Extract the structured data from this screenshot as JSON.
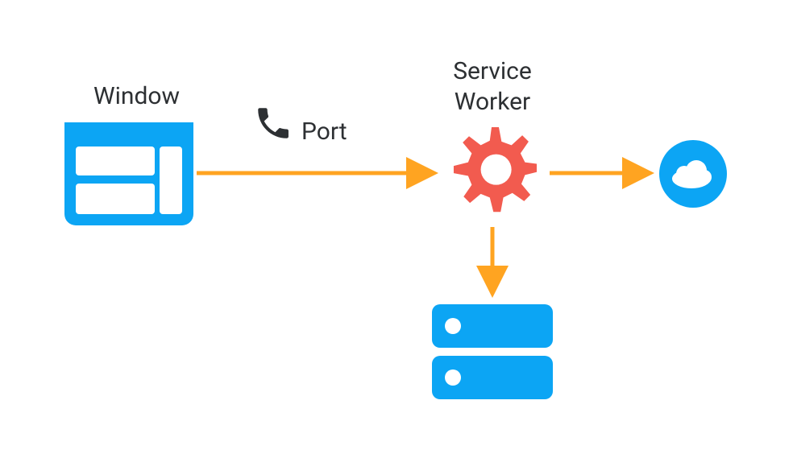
{
  "labels": {
    "window": "Window",
    "port": "Port",
    "service_worker_line1": "Service",
    "service_worker_line2": "Worker"
  },
  "colors": {
    "node_blue": "#0CA5F4",
    "gear_red": "#F25B4F",
    "arrow_orange": "#FFA421",
    "text": "#2d3033",
    "phone": "#2d3033"
  },
  "diagram": {
    "nodes": [
      {
        "id": "window",
        "type": "browser-window",
        "label_key": "window"
      },
      {
        "id": "phone",
        "type": "phone-icon",
        "label_key": "port"
      },
      {
        "id": "service-worker",
        "type": "gear",
        "label_key": "service_worker"
      },
      {
        "id": "cache",
        "type": "server"
      },
      {
        "id": "cloud",
        "type": "cloud"
      }
    ],
    "edges": [
      {
        "from": "window",
        "to": "service-worker",
        "via": "port"
      },
      {
        "from": "service-worker",
        "to": "cache"
      },
      {
        "from": "service-worker",
        "to": "cloud"
      }
    ]
  }
}
